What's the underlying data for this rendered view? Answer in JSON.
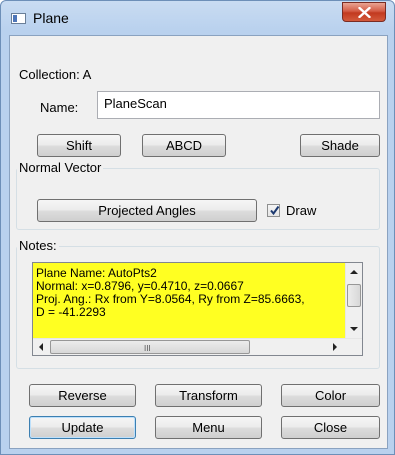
{
  "window": {
    "title": "Plane",
    "icon": "window-app-icon",
    "close_icon": "close-icon"
  },
  "collection": {
    "label": "Collection: A"
  },
  "name": {
    "label": "Name:",
    "value": "PlaneScan"
  },
  "buttons_row1": {
    "shift": "Shift",
    "abcd": "ABCD",
    "shade": "Shade"
  },
  "normal_vector": {
    "group_label": "Normal Vector",
    "projected_angles": "Projected Angles",
    "draw_label": "Draw",
    "draw_checked": true
  },
  "notes": {
    "label": "Notes:",
    "text": "Plane Name: AutoPts2\nNormal: x=0.8796, y=0.4710, z=0.0667\nProj. Ang.: Rx from Y=8.0564, Ry from Z=85.6663,\nD = -41.2293",
    "background_color": "#ffff22"
  },
  "buttons_row2": {
    "reverse": "Reverse",
    "transform": "Transform",
    "color": "Color"
  },
  "buttons_row3": {
    "update": "Update",
    "menu": "Menu",
    "close": "Close"
  }
}
